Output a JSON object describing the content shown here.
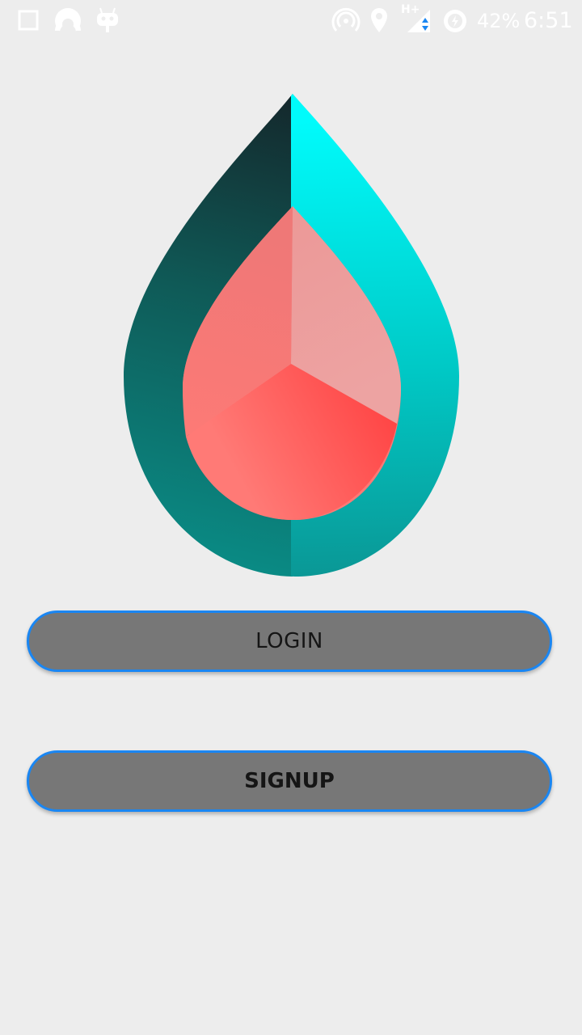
{
  "status_bar": {
    "icons": [
      "notification-square-icon",
      "headset-icon",
      "android-robot-icon",
      "hotspot-icon",
      "location-pin-icon",
      "signal-hplus-icon",
      "battery-saver-icon"
    ],
    "network_label": "H+",
    "battery_percent": "42%",
    "time": "6:51"
  },
  "logo": {
    "icon": "water-drop-logo-icon",
    "colors": {
      "outer_dark": "#14282c",
      "outer_teal": "#0a8a84",
      "outer_cyan": "#00fbfb",
      "inner_coral": "#ff6f6c",
      "inner_light": "#eda3a2",
      "inner_red": "#ff4545"
    }
  },
  "actions": {
    "login_label": "LOGIN",
    "signup_label": "SIGNUP"
  },
  "colors": {
    "background": "#ededed",
    "button_fill": "#777777",
    "button_border": "#1a86f2"
  }
}
